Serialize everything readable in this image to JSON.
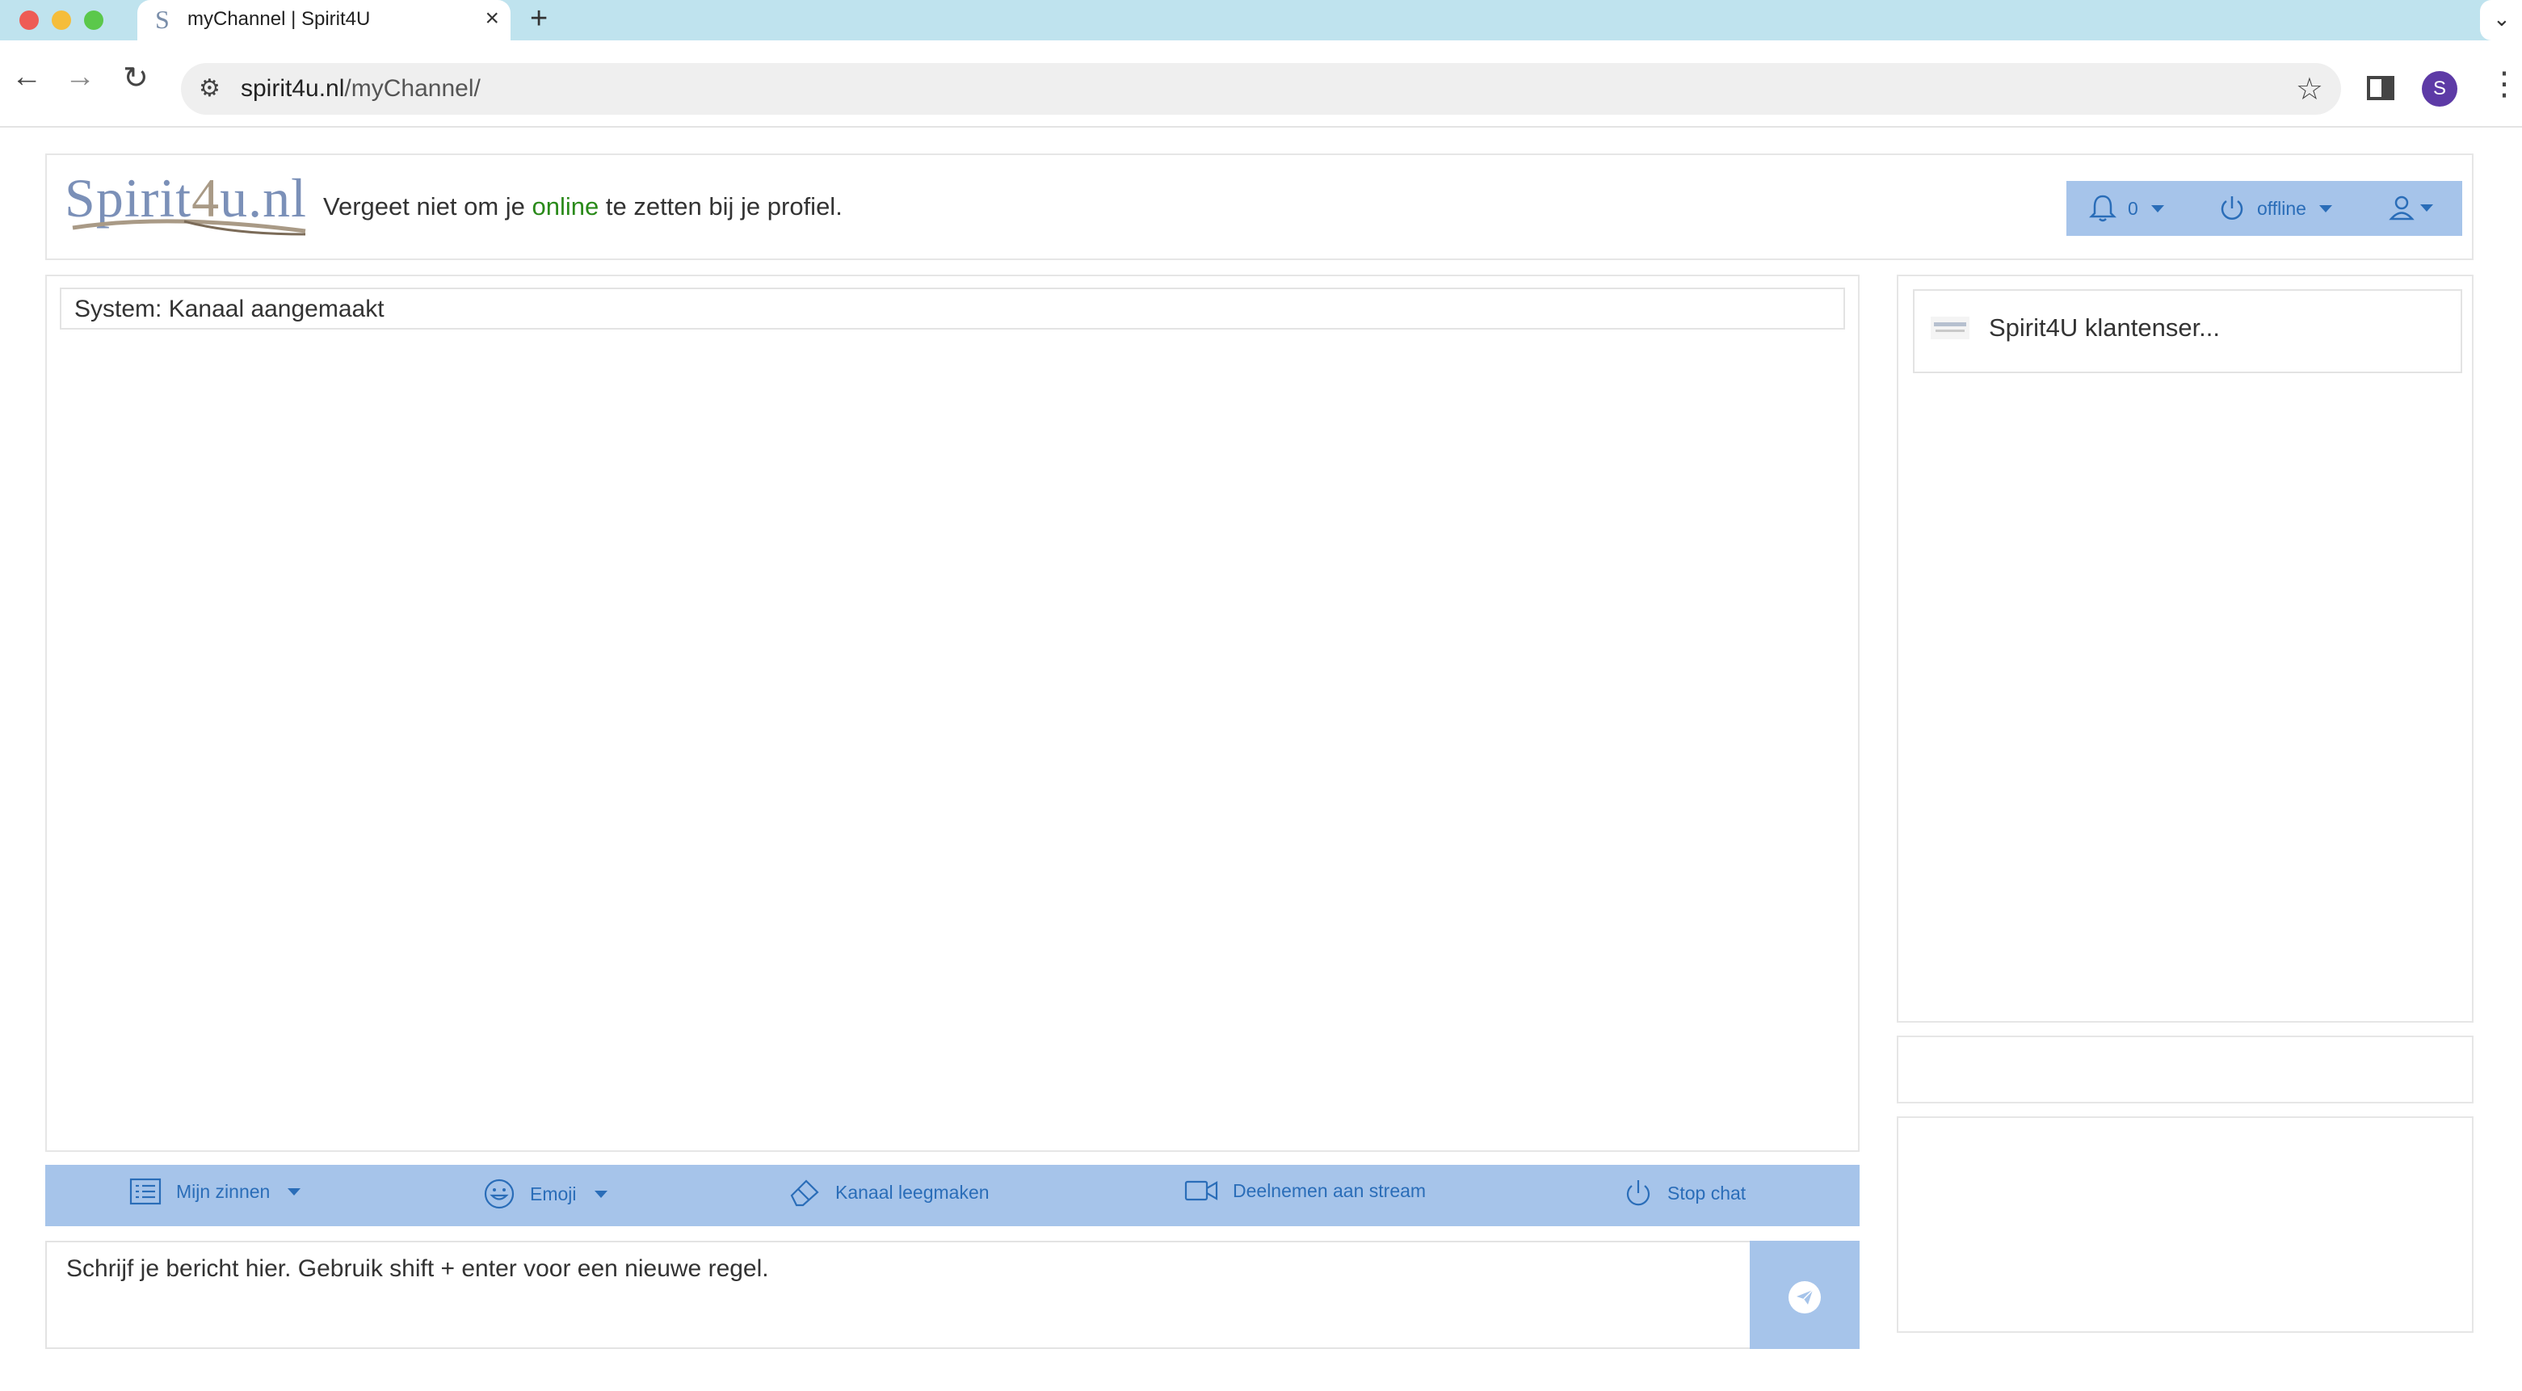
{
  "browser": {
    "tab_title": "myChannel | Spirit4U",
    "tab_favicon": "S",
    "url_domain": "spirit4u.nl",
    "url_path": "/myChannel/",
    "profile_initial": "S"
  },
  "header": {
    "logo": "Spirit4u.nl",
    "reminder_before": "Vergeet niet om je ",
    "reminder_highlight": "online",
    "reminder_after": " te zetten bij je profiel.",
    "notification_count": "0",
    "status": "offline"
  },
  "chat": {
    "messages": [
      {
        "text": "System: Kanaal aangemaakt"
      }
    ],
    "toolbar": {
      "zinnen": "Mijn zinnen",
      "emoji": "Emoji",
      "clear": "Kanaal leegmaken",
      "stream": "Deelnemen aan stream",
      "stop": "Stop chat"
    },
    "input_placeholder": "Schrijf je bericht hier. Gebruik shift + enter voor een nieuwe regel."
  },
  "sidebar": {
    "contacts": [
      {
        "name": "Spirit4U klantenser..."
      }
    ]
  },
  "colors": {
    "accent_bar": "#a6c4ea",
    "accent_text": "#2a6db8",
    "online_green": "#2a8a1a",
    "tabbar": "#bfe3ee"
  }
}
